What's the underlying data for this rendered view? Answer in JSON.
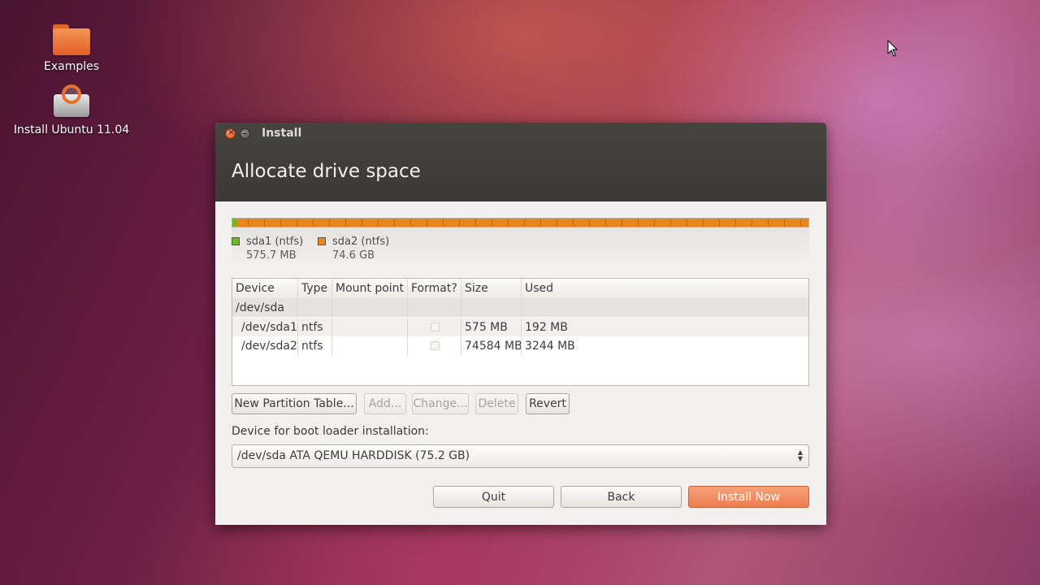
{
  "desktop": {
    "icons": [
      {
        "label": "Examples",
        "icon": "folder-icon"
      },
      {
        "label": "Install Ubuntu 11.04",
        "icon": "installer-icon"
      }
    ]
  },
  "window": {
    "title": "Install",
    "heading": "Allocate drive space"
  },
  "diskbar": {
    "partitions": [
      {
        "name": "sda1 (ntfs)",
        "size": "575.7 MB",
        "color": "#6fb91f",
        "fraction": 0.0075
      },
      {
        "name": "sda2 (ntfs)",
        "size": "74.6 GB",
        "color": "#e8861f",
        "fraction": 0.9925
      }
    ]
  },
  "table": {
    "headers": {
      "device": "Device",
      "type": "Type",
      "mount": "Mount point",
      "format": "Format?",
      "size": "Size",
      "used": "Used"
    },
    "rows": [
      {
        "device": "/dev/sda",
        "type": "",
        "mount": "",
        "size": "",
        "used": ""
      },
      {
        "device": "/dev/sda1",
        "type": "ntfs",
        "mount": "",
        "size": "575 MB",
        "used": "192 MB",
        "format_checked": false
      },
      {
        "device": "/dev/sda2",
        "type": "ntfs",
        "mount": "",
        "size": "74584 MB",
        "used": "3244 MB",
        "format_checked": false
      }
    ]
  },
  "buttons": {
    "new_partition_table": "New Partition Table...",
    "add": "Add...",
    "change": "Change...",
    "delete": "Delete",
    "revert": "Revert"
  },
  "bootloader": {
    "label": "Device for boot loader installation:",
    "selected": "/dev/sda ATA QEMU HARDDISK (75.2 GB)"
  },
  "footer": {
    "quit": "Quit",
    "back": "Back",
    "install_now": "Install Now"
  },
  "colors": {
    "accent": "#ee7d4f",
    "titlebar": "#3c3b37"
  }
}
